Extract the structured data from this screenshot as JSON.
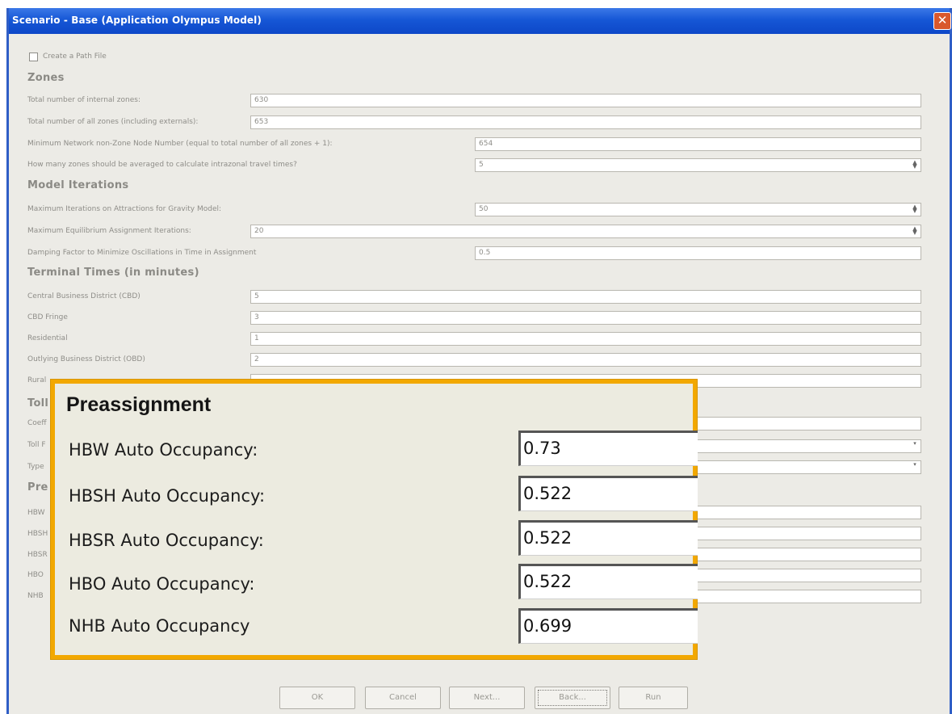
{
  "window": {
    "title": "Scenario - Base (Application Olympus Model)",
    "close_symbol": "✕"
  },
  "options": {
    "create_path_file": "Create a Path File"
  },
  "zones": {
    "heading": "Zones",
    "internal_label": "Total number of internal zones:",
    "internal_value": "630",
    "all_label": "Total number of all zones (including externals):",
    "all_value": "653",
    "min_node_label": "Minimum Network non-Zone Node Number (equal to total number of all zones + 1):",
    "min_node_value": "654",
    "avg_label": "How many zones should be averaged to calculate intrazonal travel times?",
    "avg_value": "5"
  },
  "model_iterations": {
    "heading": "Model Iterations",
    "gravity_label": "Maximum Iterations on Attractions for Gravity Model:",
    "gravity_value": "50",
    "equil_label": "Maximum Equilibrium Assignment Iterations:",
    "equil_value": "20",
    "damping_label": "Damping Factor to Minimize Oscillations in Time in Assignment",
    "damping_value": "0.5"
  },
  "terminal_times": {
    "heading": "Terminal Times (in minutes)",
    "cbd_label": "Central Business District (CBD)",
    "cbd_value": "5",
    "fringe_label": "CBD Fringe",
    "fringe_value": "3",
    "res_label": "Residential",
    "res_value": "1",
    "obd_label": "Outlying Business District (OBD)",
    "obd_value": "2",
    "rural_label": "Rural"
  },
  "background_partial": {
    "toll_heading": "Toll",
    "coef_label": "Coeff",
    "toll_f_label": "Toll F",
    "type_label": "Type",
    "pre_heading": "Pre",
    "hbw": "HBW",
    "hbsh": "HBSH",
    "hbsr": "HBSR",
    "hbo": "HBO",
    "nhb": "NHB"
  },
  "preassignment": {
    "heading": "Preassignment",
    "hbw_label": "HBW Auto Occupancy:",
    "hbw_value": "0.73",
    "hbsh_label": "HBSH Auto Occupancy:",
    "hbsh_value": "0.522",
    "hbsr_label": "HBSR Auto Occupancy:",
    "hbsr_value": "0.522",
    "hbo_label": "HBO Auto Occupancy:",
    "hbo_value": "0.522",
    "nhb_label": "NHB Auto Occupancy",
    "nhb_value": "0.699"
  },
  "buttons": {
    "ok": "OK",
    "cancel": "Cancel",
    "next": "Next...",
    "back": "Back...",
    "run": "Run"
  },
  "colors": {
    "title_bar": "#1657d6",
    "highlight_border": "#f2a800",
    "dialog_bg": "#ecebe6"
  }
}
